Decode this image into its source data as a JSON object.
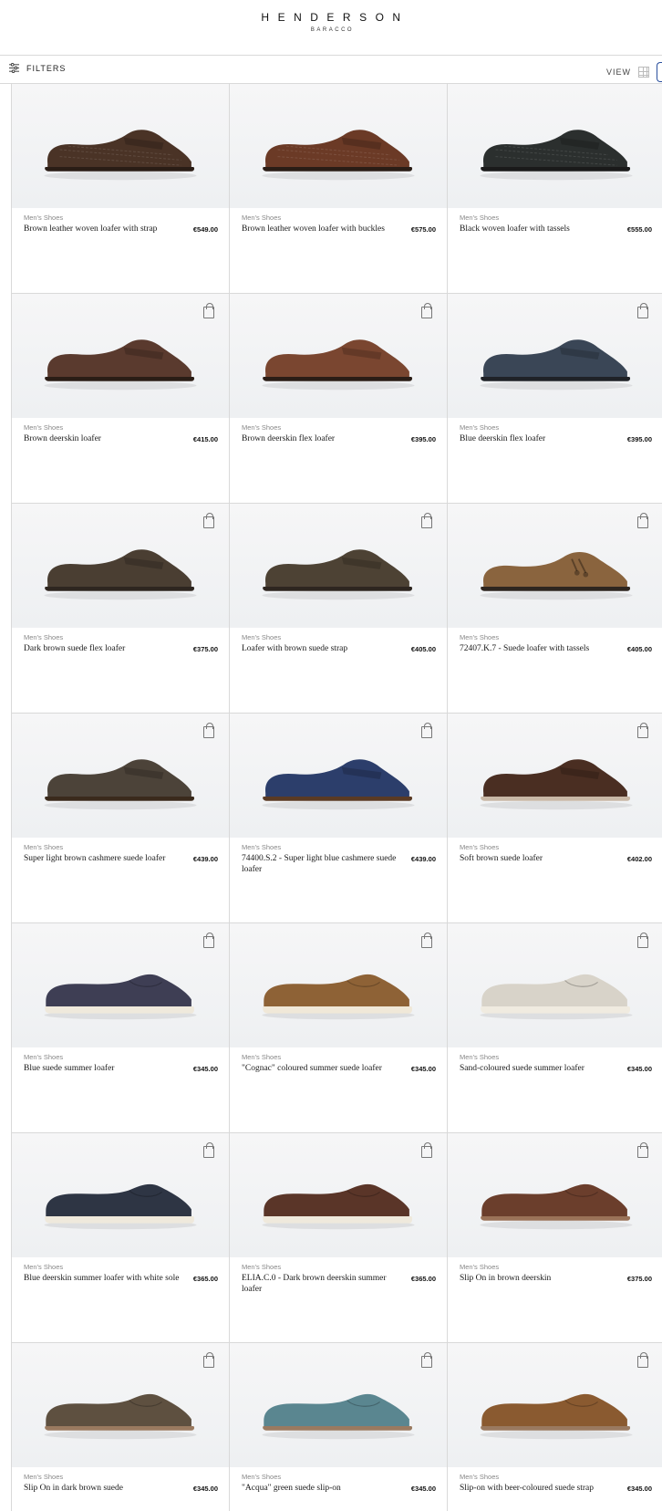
{
  "brand": {
    "name": "HENDERSON",
    "sub": "BARACCO"
  },
  "toolbar": {
    "filters_label": "FILTERS",
    "view_label": "VIEW"
  },
  "products": [
    {
      "category": "Men's Shoes",
      "name": "Brown leather woven loafer with strap",
      "price": "€549.00",
      "color": "#4a3326",
      "sole": "#2a1d16",
      "style": "woven",
      "bag": false
    },
    {
      "category": "Men's Shoes",
      "name": "Brown leather woven loafer with buckles",
      "price": "€575.00",
      "color": "#6b3a26",
      "sole": "#2a1d16",
      "style": "woven",
      "bag": false
    },
    {
      "category": "Men's Shoes",
      "name": "Black woven loafer with tassels",
      "price": "€555.00",
      "color": "#2b2f2e",
      "sole": "#1a1a1a",
      "style": "woven",
      "bag": false
    },
    {
      "category": "Men's Shoes",
      "name": "Brown deerskin loafer",
      "price": "€415.00",
      "color": "#5a3a2e",
      "sole": "#2a1d16",
      "style": "penny",
      "bag": true
    },
    {
      "category": "Men's Shoes",
      "name": "Brown deerskin flex loafer",
      "price": "€395.00",
      "color": "#7a4630",
      "sole": "#2a1d16",
      "style": "penny",
      "bag": true
    },
    {
      "category": "Men's Shoes",
      "name": "Blue deerskin flex loafer",
      "price": "€395.00",
      "color": "#3a4656",
      "sole": "#1f2227",
      "style": "penny",
      "bag": true
    },
    {
      "category": "Men's Shoes",
      "name": "Dark brown suede flex loafer",
      "price": "€375.00",
      "color": "#4a3e32",
      "sole": "#2e2620",
      "style": "penny",
      "bag": true
    },
    {
      "category": "Men's Shoes",
      "name": "Loafer with brown suede strap",
      "price": "€405.00",
      "color": "#4d4234",
      "sole": "#2e2620",
      "style": "penny",
      "bag": true
    },
    {
      "category": "Men's Shoes",
      "name": "72407.K.7 - Suede loafer with tassels",
      "price": "€405.00",
      "color": "#8a643e",
      "sole": "#2e2620",
      "style": "tassel",
      "bag": true
    },
    {
      "category": "Men's Shoes",
      "name": "Super light brown cashmere suede loafer",
      "price": "€439.00",
      "color": "#4c4339",
      "sole": "#3a2a1c",
      "style": "penny",
      "bag": true
    },
    {
      "category": "Men's Shoes",
      "name": "74400.S.2 - Super light blue cashmere suede loafer",
      "price": "€439.00",
      "color": "#2c3e6b",
      "sole": "#5a3a24",
      "style": "penny",
      "bag": true
    },
    {
      "category": "Men's Shoes",
      "name": "Soft brown suede loafer",
      "price": "€402.00",
      "color": "#4a2e22",
      "sole": "#c9b8a6",
      "style": "penny",
      "bag": true
    },
    {
      "category": "Men's Shoes",
      "name": "Blue suede summer loafer",
      "price": "€345.00",
      "color": "#3e3e54",
      "sole": "#efe9dc",
      "style": "summer",
      "bag": true
    },
    {
      "category": "Men's Shoes",
      "name": "\"Cognac\" coloured summer suede loafer",
      "price": "€345.00",
      "color": "#8e6236",
      "sole": "#f0e8d8",
      "style": "summer",
      "bag": true
    },
    {
      "category": "Men's Shoes",
      "name": "Sand-coloured suede summer loafer",
      "price": "€345.00",
      "color": "#d8d3c9",
      "sole": "#f0ebe0",
      "style": "summer",
      "bag": true
    },
    {
      "category": "Men's Shoes",
      "name": "Blue deerskin summer loafer with white sole",
      "price": "€365.00",
      "color": "#2e3544",
      "sole": "#efe9dc",
      "style": "summer",
      "bag": true
    },
    {
      "category": "Men's Shoes",
      "name": "ELIA.C.0 - Dark brown deerskin summer loafer",
      "price": "€365.00",
      "color": "#5a3528",
      "sole": "#efe9dc",
      "style": "summer",
      "bag": true
    },
    {
      "category": "Men's Shoes",
      "name": "Slip On in brown deerskin",
      "price": "€375.00",
      "color": "#6b3e2c",
      "sole": "#9a7258",
      "style": "slipon",
      "bag": true
    },
    {
      "category": "Men's Shoes",
      "name": "Slip On in dark brown suede",
      "price": "€345.00",
      "color": "#5e5040",
      "sole": "#9a7a60",
      "style": "slipon",
      "bag": true
    },
    {
      "category": "Men's Shoes",
      "name": "\"Acqua\" green suede slip-on",
      "price": "€345.00",
      "color": "#5a8690",
      "sole": "#9a7a60",
      "style": "slipon",
      "bag": true
    },
    {
      "category": "Men's Shoes",
      "name": "Slip-on with beer-coloured suede strap",
      "price": "€345.00",
      "color": "#8a5a30",
      "sole": "#9a7a60",
      "style": "slipon",
      "bag": true
    }
  ]
}
